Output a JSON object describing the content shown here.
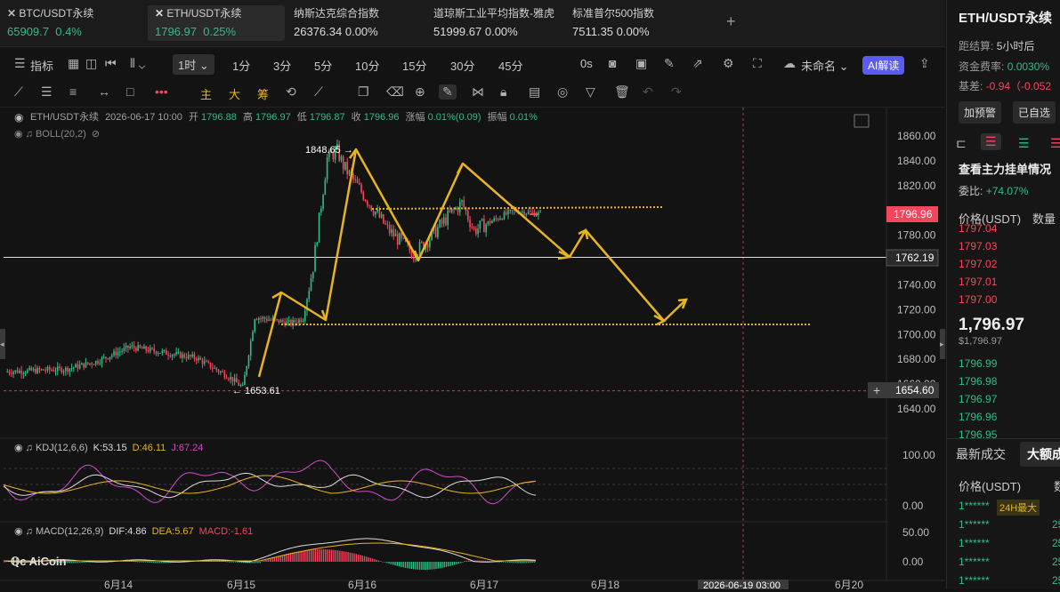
{
  "tickers": [
    {
      "name": "BTC/USDT永续",
      "price": "65909.7",
      "change": "0.4%",
      "dir": "up",
      "icon": "btc-logo-icon"
    },
    {
      "name": "ETH/USDT永续",
      "price": "1796.97",
      "change": "0.25%",
      "dir": "up",
      "icon": "eth-logo-icon"
    },
    {
      "name": "纳斯达克综合指数",
      "price": "26376.34",
      "change": "0.00%",
      "dir": "flat"
    },
    {
      "name": "道琼斯工业平均指数-雅虎",
      "price": "51999.67",
      "change": "0.00%",
      "dir": "flat"
    },
    {
      "name": "标准普尔500指数",
      "price": "7511.35",
      "change": "0.00%",
      "dir": "flat"
    }
  ],
  "add_tab_label": "+",
  "toolbar": {
    "indicators_label": "指标",
    "interval_selected": "1时",
    "intervals": [
      "1分",
      "3分",
      "5分",
      "10分",
      "15分",
      "30分",
      "45分"
    ],
    "seconds_label": "0s",
    "layout_name": "未命名",
    "ai_label": "AI解读"
  },
  "draw_tools": {
    "main_label": "主",
    "big_label": "大",
    "chip_label": "筹"
  },
  "chart_info": {
    "symbol": "ETH/USDT永续",
    "datetime": "2026-06-17 10:00",
    "open_label": "开",
    "open": "1796.88",
    "high_label": "高",
    "high": "1796.97",
    "low_label": "低",
    "low": "1796.87",
    "close_label": "收",
    "close": "1796.96",
    "chg_label": "涨幅",
    "chg": "0.01%(0.09)",
    "amp_label": "振幅",
    "amp": "0.01%",
    "boll_label": "BOLL(20,2)",
    "kdj_label": "KDJ(12,6,6)",
    "kdj_k": "K:53.15",
    "kdj_d": "D:46.11",
    "kdj_j": "J:67.24",
    "macd_label": "MACD(12,26,9)",
    "macd_dif": "DIF:4.86",
    "macd_dea": "DEA:5.67",
    "macd_val": "MACD:-1.61"
  },
  "price_axis": [
    "1860.00",
    "1840.00",
    "1820.00",
    "1800.00",
    "1780.00",
    "1760.00",
    "1740.00",
    "1720.00",
    "1700.00",
    "1680.00",
    "1660.00",
    "1640.00"
  ],
  "price_tags": {
    "current": "1796.96",
    "line": "1762.19",
    "crosshair": "1654.60"
  },
  "annotations": {
    "high": "1848.65 →",
    "low": "← 1653.61"
  },
  "kdj_axis": [
    "100.00",
    "0.00"
  ],
  "macd_axis": [
    "50.00",
    "0.00"
  ],
  "time_axis": [
    "6月14",
    "6月15",
    "6月16",
    "6月17",
    "6月18",
    "6月20"
  ],
  "time_crosshair": "2026-06-19 03:00",
  "logo_text": "AiCoin",
  "colors": {
    "up": "#2ebd85",
    "down": "#f6465d",
    "drawing": "#e6b422",
    "kdj_j": "#d04cc8"
  },
  "panel": {
    "title": "ETH/USDT永续",
    "settle_label": "距结算:",
    "settle_value": "5小时后",
    "funding_label": "资金费率:",
    "funding_value": "0.0030%",
    "basis_label": "基差:",
    "basis_value": "-0.94（-0.052",
    "alert_btn": "加预警",
    "fav_btn": "已自选",
    "orders_title": "查看主力挂单情况",
    "ratio_label": "委比:",
    "ratio_value": "+74.07%",
    "col_price": "价格(USDT)",
    "col_qty": "数量",
    "asks": [
      "1797.04",
      "1797.03",
      "1797.02",
      "1797.01",
      "1797.00"
    ],
    "last_price": "1,796.97",
    "last_usd": "$1,796.97",
    "bids": [
      "1796.99",
      "1796.98",
      "1796.97",
      "1796.96",
      "1796.95"
    ],
    "trades_tab": "最新成交",
    "bigtrades_tab": "大额成",
    "trades_col_price": "价格(USDT)",
    "trades_col_qty": "数",
    "trades": [
      {
        "price": "1******",
        "badge": "24H最大",
        "qty": ""
      },
      {
        "price": "1******",
        "badge": "",
        "qty": "25"
      },
      {
        "price": "1******",
        "badge": "",
        "qty": "25"
      },
      {
        "price": "1******",
        "badge": "",
        "qty": "25"
      },
      {
        "price": "1******",
        "badge": "",
        "qty": "25"
      }
    ]
  }
}
